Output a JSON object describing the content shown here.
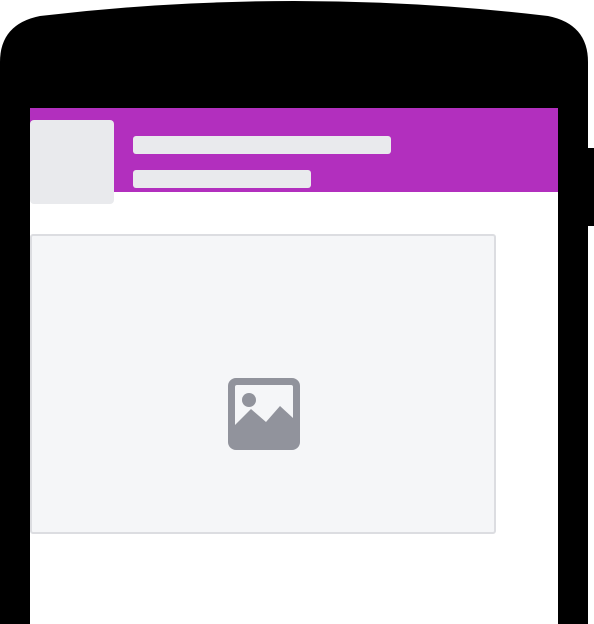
{
  "colors": {
    "device_frame": "#000000",
    "app_bar": "#b22fbe",
    "skeleton": "#e9eaed",
    "media_background": "#f5f6f8",
    "media_border": "#dcdde1",
    "icon": "#91939c",
    "screen": "#ffffff"
  },
  "device": {
    "type": "phone"
  },
  "app_bar": {
    "title": ""
  },
  "post_header": {
    "avatar": "placeholder",
    "text_lines": 2
  },
  "media": {
    "icon": "image-icon"
  }
}
